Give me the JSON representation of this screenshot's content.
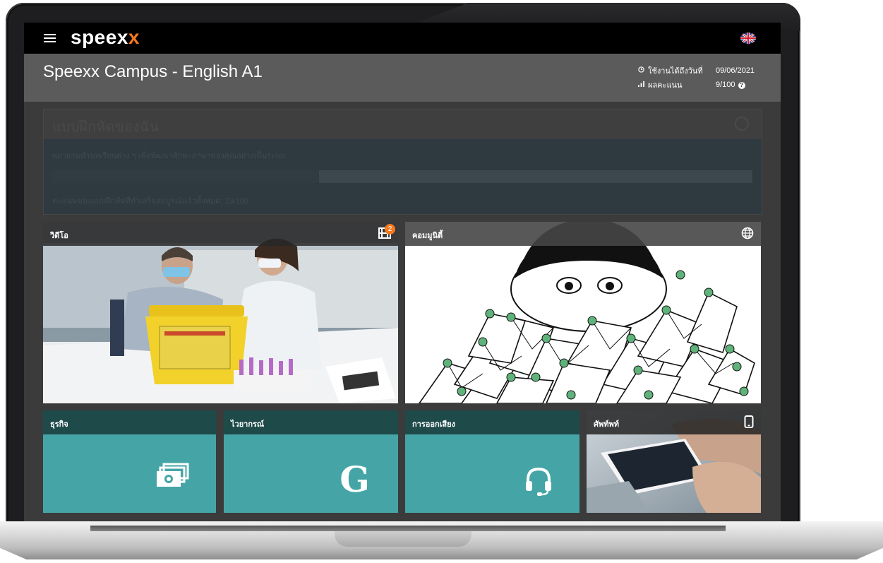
{
  "app": {
    "logo_main": "speex",
    "logo_accent": "x",
    "accent_color": "#f47920",
    "teal_color": "#45a5a6",
    "dark_teal_color": "#1f4a4a"
  },
  "header": {
    "course_title": "Speexx Campus - English A1",
    "valid_until_label": "ใช้งานได้ถึงวันที่",
    "valid_until_value": "09/06/2021",
    "score_label": "ผลคะแนน",
    "score_value": "9/100"
  },
  "practice": {
    "title": "แบบฝึกหัดของฉัน",
    "description": "พยายามทำบทเรียนต่าง ๆ เพื่อพัฒนาทักษะภาษาของคุณอย่างเป็นระบบ",
    "score_text": "คะแนนของแบบฝึกหัดที่ทำเสร็จสมบูรณ์แล้วทั้งหมด: 23/100"
  },
  "tiles": {
    "video": {
      "label": "วิดีโอ",
      "badge": "2",
      "icon": "film-icon"
    },
    "community": {
      "label": "คอมมูนิตี้",
      "icon": "globe-icon"
    },
    "business": {
      "label": "ธุรกิจ",
      "icon": "money-stack-icon"
    },
    "grammar": {
      "label": "ไวยากรณ์",
      "glyph": "G",
      "icon": "grammar-g-icon"
    },
    "pronunciation": {
      "label": "การออกเสียง",
      "icon": "headset-icon"
    },
    "phone": {
      "label": "ศัพท์พท์",
      "icon": "mobile-icon"
    }
  }
}
